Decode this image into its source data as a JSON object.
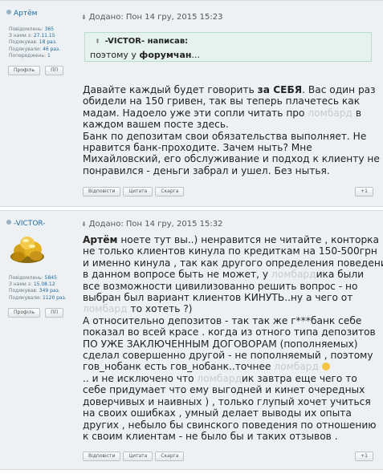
{
  "posts": [
    {
      "author": "Артём",
      "stats": [
        {
          "label": "Повідомлень:",
          "value": "365"
        },
        {
          "label": "З нами з:",
          "value": "27.11.15"
        },
        {
          "label": "Подякував:",
          "value": "18 раз."
        },
        {
          "label": "Подякували:",
          "value": "46 раз."
        },
        {
          "label": "Попереджень:",
          "value": "1"
        }
      ],
      "profile_btn": "Профіль",
      "pm_btn": "ПП",
      "date": "Додано: Пон 14 гру, 2015 15:23",
      "quote_author": "-VICTOR- написав:",
      "quote_text_pre": "поэтому у ",
      "quote_text_bold": "форумчан",
      "quote_text_post": "...",
      "lines": [
        [
          "Давайте каждый будет говорить ",
          {
            "b": "за СЕБЯ"
          },
          ". Вас один раз"
        ],
        [
          "обидели на 150 гривен, так вы теперь плачетесь как"
        ],
        [
          "мадам. Надоело уже эти сопли читать про ",
          {
            "g": "ломбард"
          },
          " в"
        ],
        [
          "каждом вашем посте здесь."
        ],
        [
          "Банк по депозитам свои обязательства выполняет. Не"
        ],
        [
          "нравится банк-проходите. Зачем ныть? Мне"
        ],
        [
          "Михайловский, его обслуживание и подход к клиенту не"
        ],
        [
          "понравился - деньги забрал и ушел. Без нытья."
        ]
      ],
      "buttons": [
        "Відповісти",
        "Цитата",
        "Скарга"
      ],
      "plus": "+1"
    },
    {
      "author": "-VICTOR-",
      "stats": [
        {
          "label": "Повідомлень:",
          "value": "5845"
        },
        {
          "label": "З нами з:",
          "value": "15.08.12"
        },
        {
          "label": "Подякував:",
          "value": "349 раз."
        },
        {
          "label": "Подякували:",
          "value": "1120 раз."
        }
      ],
      "profile_btn": "Профіль",
      "pm_btn": "ПП",
      "date": "Додано: Пон 14 гру, 2015 15:32",
      "lines": [
        [
          {
            "b": "Артём"
          },
          " ноете тут вы..) ненравится не читайте , конторка"
        ],
        [
          "не только клиентов кинула по кредиткам на 150-500грн"
        ],
        [
          "и именно кинула , так как другого определения поведения"
        ],
        [
          "в данном вопросе быть не может, у ",
          {
            "g": "ломбард"
          },
          "ика были"
        ],
        [
          "все возможности цивилизованно решить вопрос - но"
        ],
        [
          "выбран был вариант клиентов КИНУТЬ..ну а чего от"
        ],
        [
          {
            "g": "ломбард"
          },
          " то хотеть ?)"
        ],
        [
          "А относительно депозитов - так так же г***банк себе"
        ],
        [
          "показал во всей красе . когда из отного типа депозитов"
        ],
        [
          "ПО УЖЕ ЗАКЛЮЧЕННЫМ ДОГОВОРАМ (пополняемых)"
        ],
        [
          "сделал совершенно другой - не пополняемый , поэтому"
        ],
        [
          "гов_нобанк есть гов_нобанк..точнее ",
          {
            "g": "ломбард"
          },
          " ",
          {
            "e": "😄"
          }
        ],
        [
          ".. и не исключено что ",
          {
            "g": "ломбард"
          },
          "ик завтра еще чего то"
        ],
        [
          "себе придумает что ему выгодней и кинет очередных"
        ],
        [
          "доверчивых и наивных ) , только глупый хочет учиться"
        ],
        [
          "на своих ошибках , умный делает выводы их опыта"
        ],
        [
          "других , небыло бы свинского поведения по отношению"
        ],
        [
          "к своим клиентам - не было бы и таких отзывов ."
        ]
      ],
      "buttons": [
        "Відповісти",
        "Цитата",
        "Скарга"
      ],
      "plus": "+1"
    }
  ]
}
